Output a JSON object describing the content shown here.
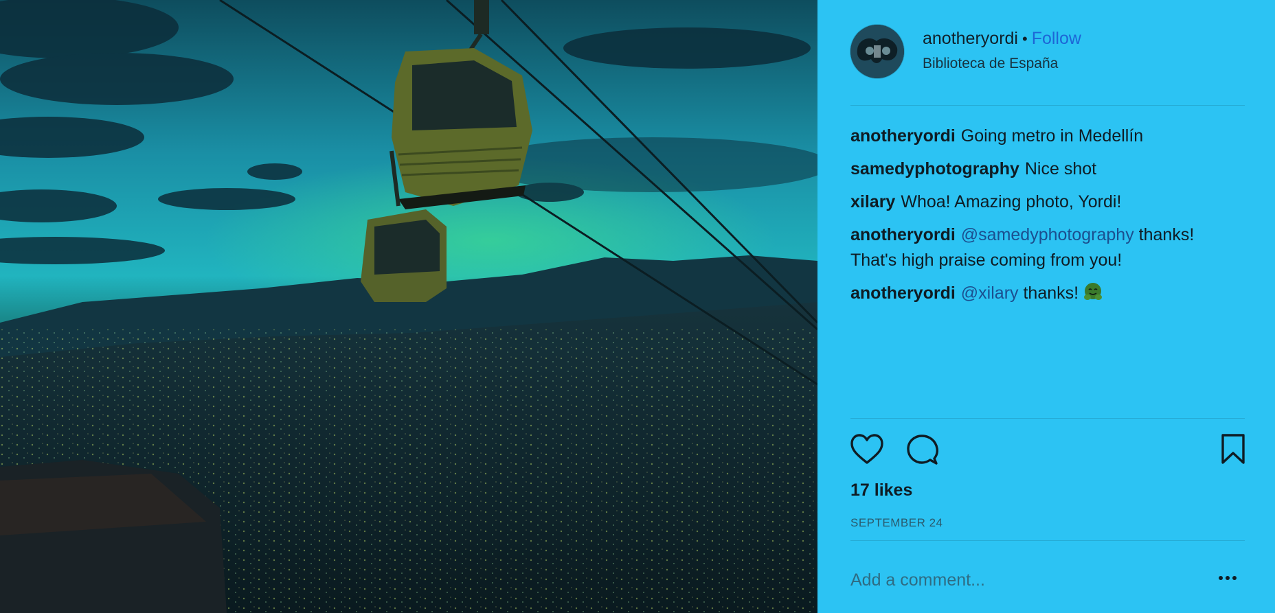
{
  "post": {
    "username": "anotheryordi",
    "separator": "•",
    "follow_label": "Follow",
    "location": "Biblioteca de España",
    "likes_text": "17 likes",
    "date": "SEPTEMBER 24",
    "comment_placeholder": "Add a comment...",
    "avatar_icon": "profile-avatar",
    "photo_description_icon": "cable-car-city-photo"
  },
  "comments": [
    {
      "author": "anotheryordi",
      "text": "Going metro in Medellín"
    },
    {
      "author": "samedyphotography",
      "text": "Nice shot"
    },
    {
      "author": "xilary",
      "text": "Whoa! Amazing photo, Yordi!"
    },
    {
      "author": "anotheryordi",
      "mention": "@samedyphotography",
      "text": "thanks! That's high praise coming from you!"
    },
    {
      "author": "anotheryordi",
      "mention": "@xilary",
      "text": "thanks!",
      "emoji": "hugging-face-emoji"
    }
  ],
  "icons": {
    "like": "heart-icon",
    "comment": "speech-bubble-icon",
    "save": "bookmark-icon",
    "more": "more-options-icon"
  },
  "colors": {
    "sidebar_bg": "#2cc3f3",
    "follow": "#1d66d6",
    "mention": "#1b4f8f"
  }
}
